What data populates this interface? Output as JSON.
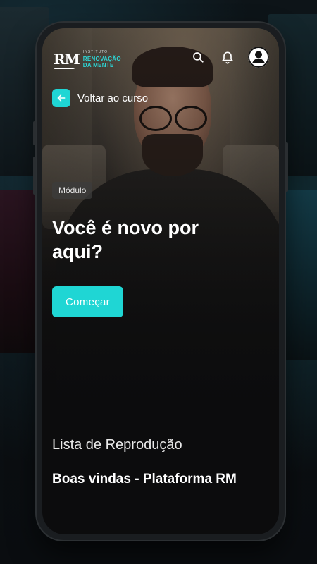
{
  "app": {
    "logo": {
      "mark": "RM",
      "line_small": "INSTITUTO",
      "line_big_1": "RENOVAÇÃO",
      "line_big_2": "DA MENTE"
    }
  },
  "header": {
    "icons": [
      "search-icon",
      "bell-icon",
      "user-avatar-icon"
    ]
  },
  "back": {
    "label": "Voltar ao curso",
    "icon": "arrow-left-icon"
  },
  "hero": {
    "tag": "Módulo",
    "title": "Você é novo por aqui?",
    "cta": "Começar"
  },
  "playlist": {
    "heading": "Lista de Reprodução",
    "items": [
      {
        "title": "Boas vindas - Plataforma RM"
      }
    ]
  },
  "colors": {
    "accent": "#1fd6d4",
    "background": "#0c0c0d",
    "text": "#ffffff"
  }
}
